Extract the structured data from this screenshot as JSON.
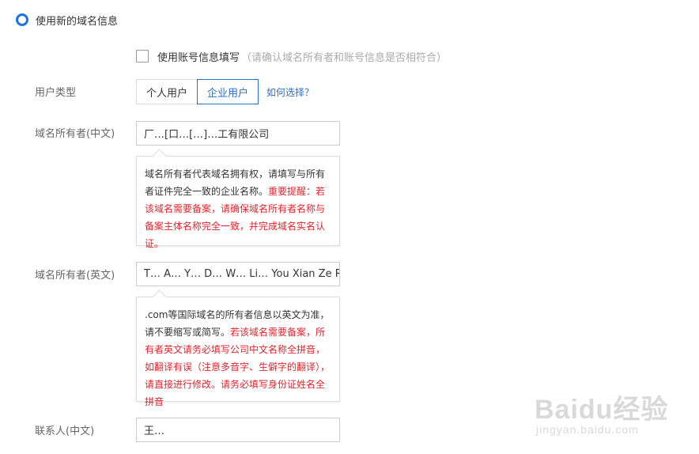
{
  "option": {
    "label": "使用新的域名信息",
    "selected": true
  },
  "account_fill": {
    "label": "使用账号信息填写",
    "hint": "（请确认域名所有者和账号信息是否相符合）",
    "checked": false
  },
  "user_type": {
    "label": "用户类型",
    "options": [
      "个人用户",
      "企业用户"
    ],
    "selected": "企业用户",
    "help_link": "如何选择？"
  },
  "owner_cn": {
    "label": "域名所有者(中文)",
    "value": "厂…[口…[…]…工有限公司",
    "tip_normal": "域名所有者代表域名拥有权，请填写与所有者证件完全一致的企业名称。",
    "tip_red": "重要提醒：若该域名需要备案，请确保域名所有者名称与备案主体名称完全一致，并完成域名实名认证。"
  },
  "owner_en": {
    "label": "域名所有者(英文)",
    "value": "T… A… Y… D… W… Li… You Xian Ze Ren Gong",
    "tip_normal": ".com等国际域名的所有者信息以英文为准，请不要缩写或简写。",
    "tip_red": "若该域名需要备案，所有者英文请务必填写公司中文名称全拼音，如翻译有误（注意多音字、生僻字的翻译），请直接进行修改。请务必填写身份证姓名全拼音"
  },
  "contact_cn": {
    "label": "联系人(中文)",
    "value": "王…"
  },
  "watermark": {
    "brand": "Baidu经验",
    "site": "jingyan.baidu.com"
  },
  "colors": {
    "accent": "#2a6fc9",
    "radio": "#1a73e8",
    "warning": "#e0262f",
    "label": "#666666",
    "hint": "#aaaaaa"
  }
}
